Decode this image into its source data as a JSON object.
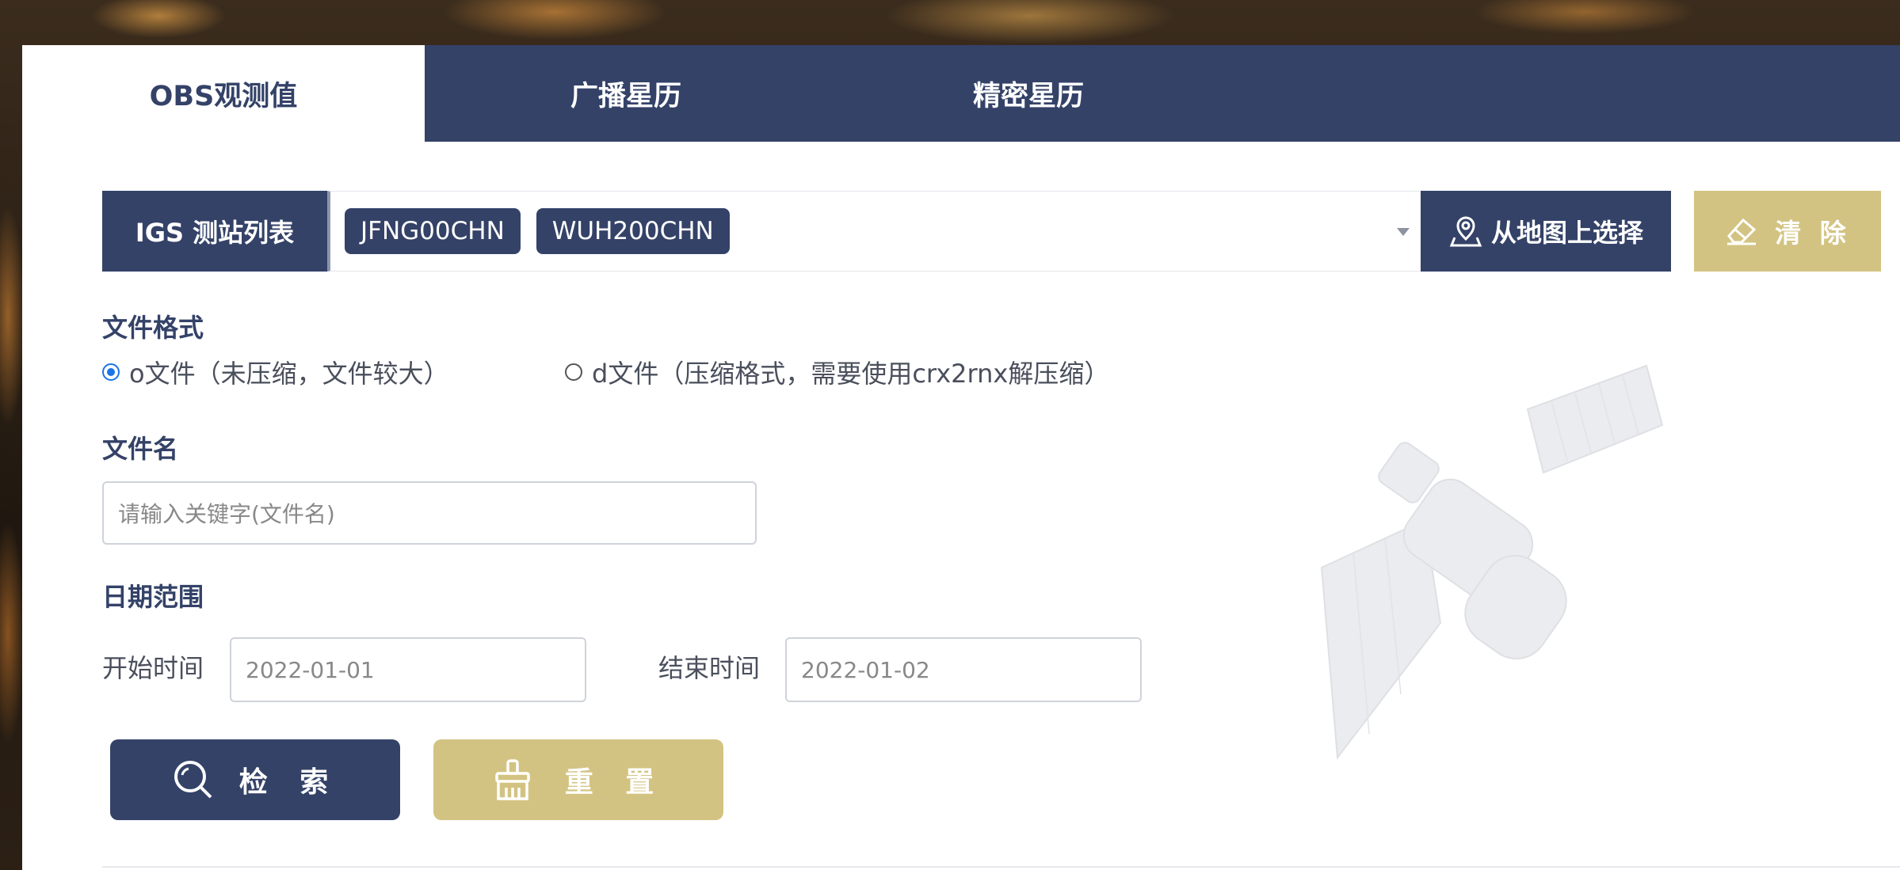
{
  "tabs": [
    {
      "label": "OBS观测值",
      "active": true
    },
    {
      "label": "广播星历",
      "active": false
    },
    {
      "label": "精密星历",
      "active": false
    }
  ],
  "stations": {
    "label": "IGS 测站列表",
    "selected": [
      "JFNG00CHN",
      "WUH200CHN"
    ],
    "map_button": "从地图上选择",
    "clear_button": "清 除"
  },
  "file_format": {
    "label": "文件格式",
    "options": [
      {
        "label": "o文件（未压缩，文件较大）",
        "checked": true
      },
      {
        "label": "d文件（压缩格式，需要使用crx2rnx解压缩）",
        "checked": false
      }
    ]
  },
  "file_name": {
    "label": "文件名",
    "placeholder": "请输入关键字(文件名)"
  },
  "date_range": {
    "label": "日期范围",
    "start_label": "开始时间",
    "start_value": "2022-01-01",
    "end_label": "结束时间",
    "end_value": "2022-01-02"
  },
  "actions": {
    "search": "检 索",
    "reset": "重 置"
  },
  "colors": {
    "primary": "#344268",
    "gold": "#d3c382",
    "radio": "#1a73e8"
  }
}
